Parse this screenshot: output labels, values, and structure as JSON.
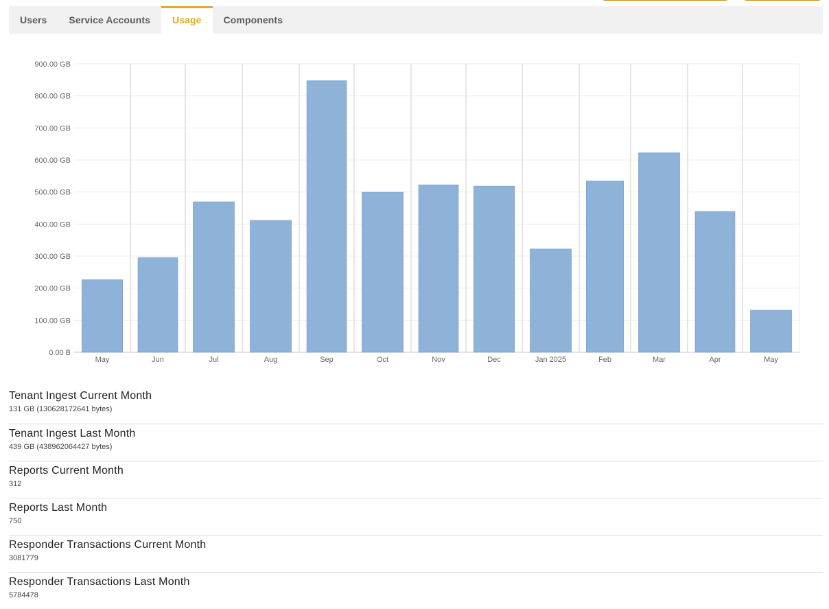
{
  "tabs": [
    {
      "label": "Users",
      "active": false
    },
    {
      "label": "Service Accounts",
      "active": false
    },
    {
      "label": "Usage",
      "active": true
    },
    {
      "label": "Components",
      "active": false
    }
  ],
  "colors": {
    "accent": "#e0a92a",
    "bar": "#8fb3d8",
    "tab_bar_bg": "#f1f1f1"
  },
  "chart_data": {
    "type": "bar",
    "categories": [
      "May",
      "Jun",
      "Jul",
      "Aug",
      "Sep",
      "Oct",
      "Nov",
      "Dec",
      "Jan 2025",
      "Feb",
      "Mar",
      "Apr",
      "May"
    ],
    "values": [
      226,
      295,
      469,
      411,
      847,
      499,
      522,
      518,
      322,
      534,
      622,
      439,
      131
    ],
    "unit": "GB",
    "ylim": [
      0,
      900
    ],
    "yticks": [
      0,
      100,
      200,
      300,
      400,
      500,
      600,
      700,
      800,
      900
    ],
    "ytick_labels": [
      "0.00 B",
      "100.00 GB",
      "200.00 GB",
      "300.00 GB",
      "400.00 GB",
      "500.00 GB",
      "600.00 GB",
      "700.00 GB",
      "800.00 GB",
      "900.00 GB"
    ],
    "grid": true,
    "title": "",
    "xlabel": "",
    "ylabel": ""
  },
  "stats": [
    {
      "title": "Tenant Ingest Current Month",
      "value": "131 GB (130628172641 bytes)"
    },
    {
      "title": "Tenant Ingest Last Month",
      "value": "439 GB (438962064427 bytes)"
    },
    {
      "title": "Reports Current Month",
      "value": "312"
    },
    {
      "title": "Reports Last Month",
      "value": "750"
    },
    {
      "title": "Responder Transactions Current Month",
      "value": "3081779"
    },
    {
      "title": "Responder Transactions Last Month",
      "value": "5784478"
    }
  ]
}
